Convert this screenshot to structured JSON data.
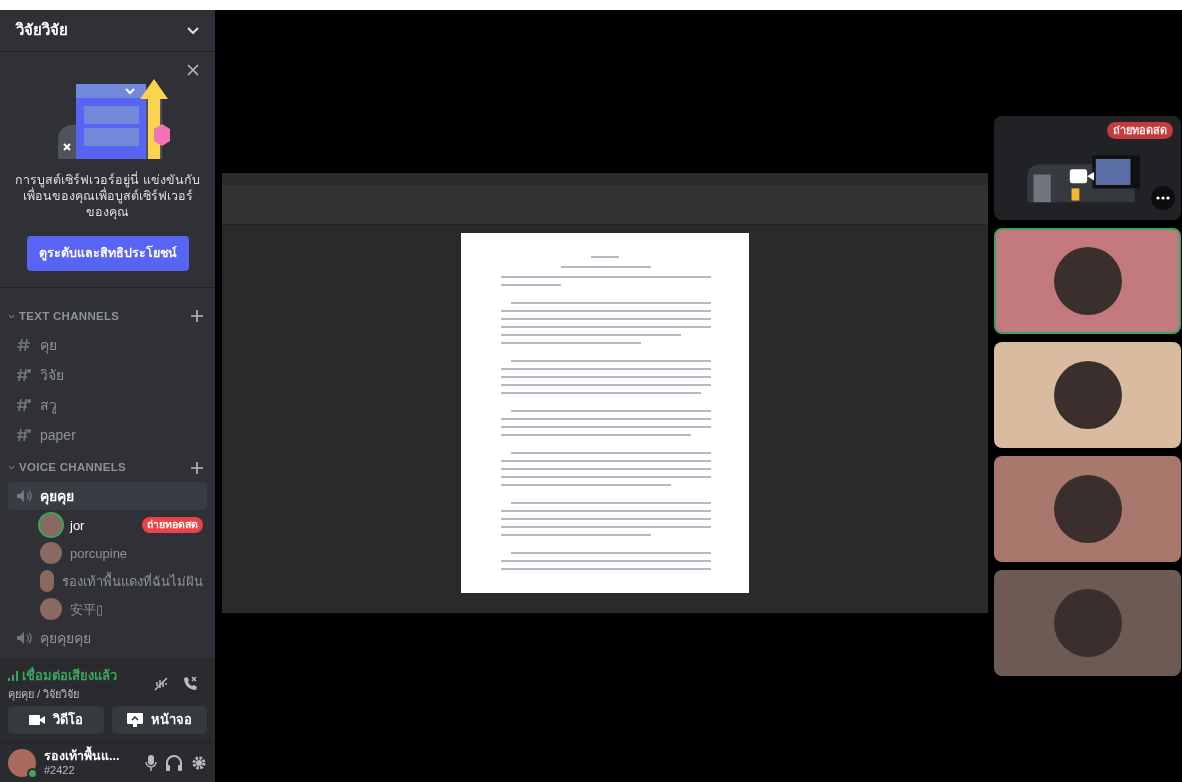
{
  "server": {
    "name": "วิจัยวิจัย"
  },
  "boost_card": {
    "text": "การบูสต์เซิร์ฟเวอร์อยู่นี่ แข่งขันกับเพื่อนของคุณเพื่อบูสต์เซิร์ฟเวอร์ของคุณ",
    "button": "ดูระดับและสิทธิประโยชน์"
  },
  "text_channels": {
    "header": "TEXT CHANNELS",
    "items": [
      {
        "name": "คุย",
        "kind": "plain"
      },
      {
        "name": "วิจัย",
        "kind": "thread"
      },
      {
        "name": "สวู",
        "kind": "thread"
      },
      {
        "name": "paper",
        "kind": "thread"
      }
    ]
  },
  "voice_channels": {
    "header": "VOICE CHANNELS",
    "items": [
      {
        "name": "คุยคุย",
        "selected": true,
        "children": [
          {
            "name": "jor",
            "speaking": true,
            "live": "ถ่ายทอดสด"
          },
          {
            "name": "porcupine",
            "speaking": false
          },
          {
            "name": "รองเท้าพื้นแดงที่ฉันไม่ฝัน",
            "speaking": false
          },
          {
            "name": "安平▯",
            "speaking": false
          }
        ]
      },
      {
        "name": "คุยคุยคุย",
        "selected": false
      }
    ]
  },
  "voice_panel": {
    "status": "เชื่อมต่อเสียงแล้ว",
    "location": "คุยคุย / วิจัยวิจัย",
    "buttons": [
      "วิดีโอ",
      "หน้าจอ"
    ]
  },
  "user_panel": {
    "name": "รองเท้าพื้นแ...",
    "tag": "#2422"
  },
  "tiles": [
    {
      "kind": "stream",
      "badge": "ถ่ายทอดสด",
      "speaking": false
    },
    {
      "kind": "participant",
      "speaking": true,
      "color": "#c27a7e"
    },
    {
      "kind": "participant",
      "speaking": false,
      "color": "#d9bca0"
    },
    {
      "kind": "participant",
      "speaking": false,
      "color": "#a9786c"
    },
    {
      "kind": "participant",
      "speaking": false,
      "color": "#6d5a52"
    }
  ]
}
